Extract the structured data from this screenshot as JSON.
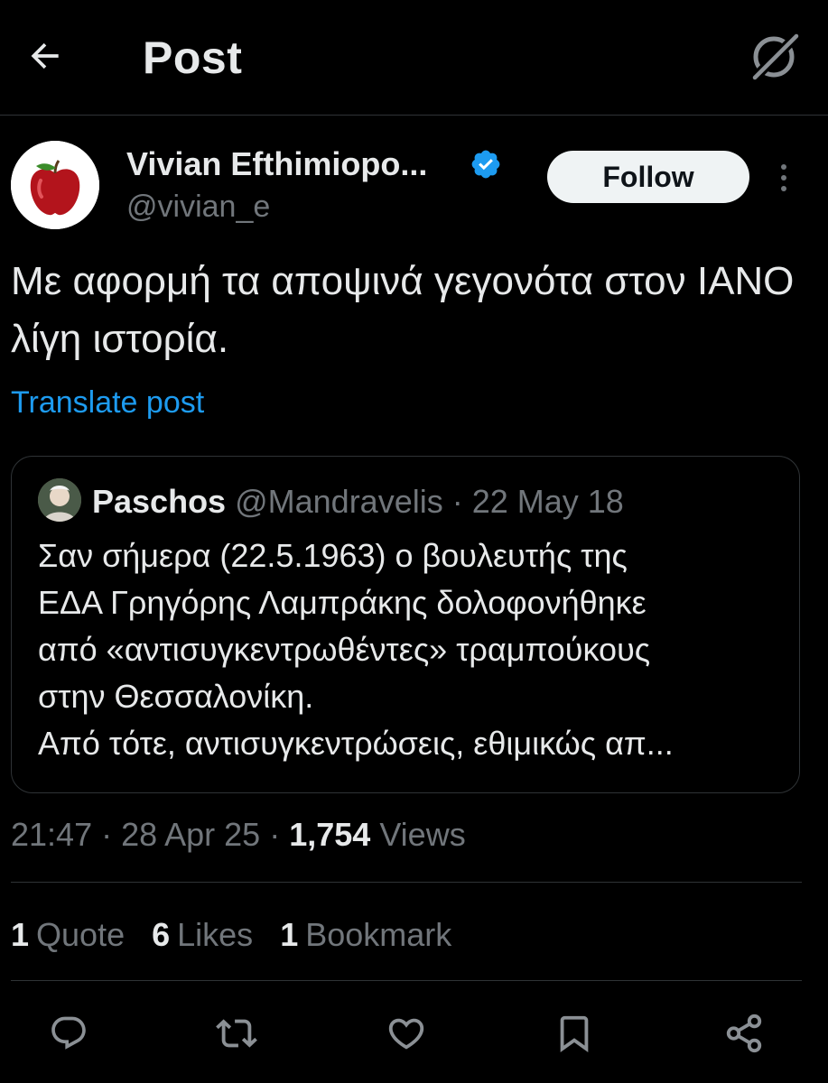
{
  "header": {
    "title": "Post",
    "back_icon": "arrow-left-icon",
    "grok_icon": "grok-icon"
  },
  "author": {
    "name": "Vivian Efthimiopo...",
    "handle": "@vivian_e",
    "verified_color": "#1d9bf0",
    "avatar_icon": "apple-icon"
  },
  "follow_label": "Follow",
  "post": {
    "text": "Με αφορμή τα αποψινά γεγονότα στον ΙΑΝΟ λίγη ιστορία.",
    "translate_label": "Translate post"
  },
  "quote": {
    "name": "Paschos",
    "handle": "@Mandravelis",
    "date": " · 22 May 18",
    "lines": [
      "Σαν σήμερα (22.5.1963) ο βουλευτής της",
      "ΕΔΑ Γρηγόρης Λαμπράκης δολοφονήθηκε",
      "από «αντισυγκεντρωθέντες» τραμπούκους",
      "στην Θεσσαλονίκη.",
      "Από τότε, αντισυγκεντρώσεις, εθιμικώς απ..."
    ]
  },
  "meta": {
    "time_date": "21:47 · 28 Apr 25 · ",
    "views_count": "1,754",
    "views_label": "Views"
  },
  "stats": {
    "quotes_count": "1",
    "quotes_label": "Quote",
    "likes_count": "6",
    "likes_label": "Likes",
    "bookmarks_count": "1",
    "bookmarks_label": "Bookmark"
  },
  "actions": [
    "reply-icon",
    "repost-icon",
    "like-icon",
    "bookmark-icon",
    "share-icon"
  ],
  "colors": {
    "background": "#000000",
    "text": "#e7e9ea",
    "secondary": "#71767b",
    "accent": "#1d9bf0",
    "divider": "#2f3336"
  }
}
